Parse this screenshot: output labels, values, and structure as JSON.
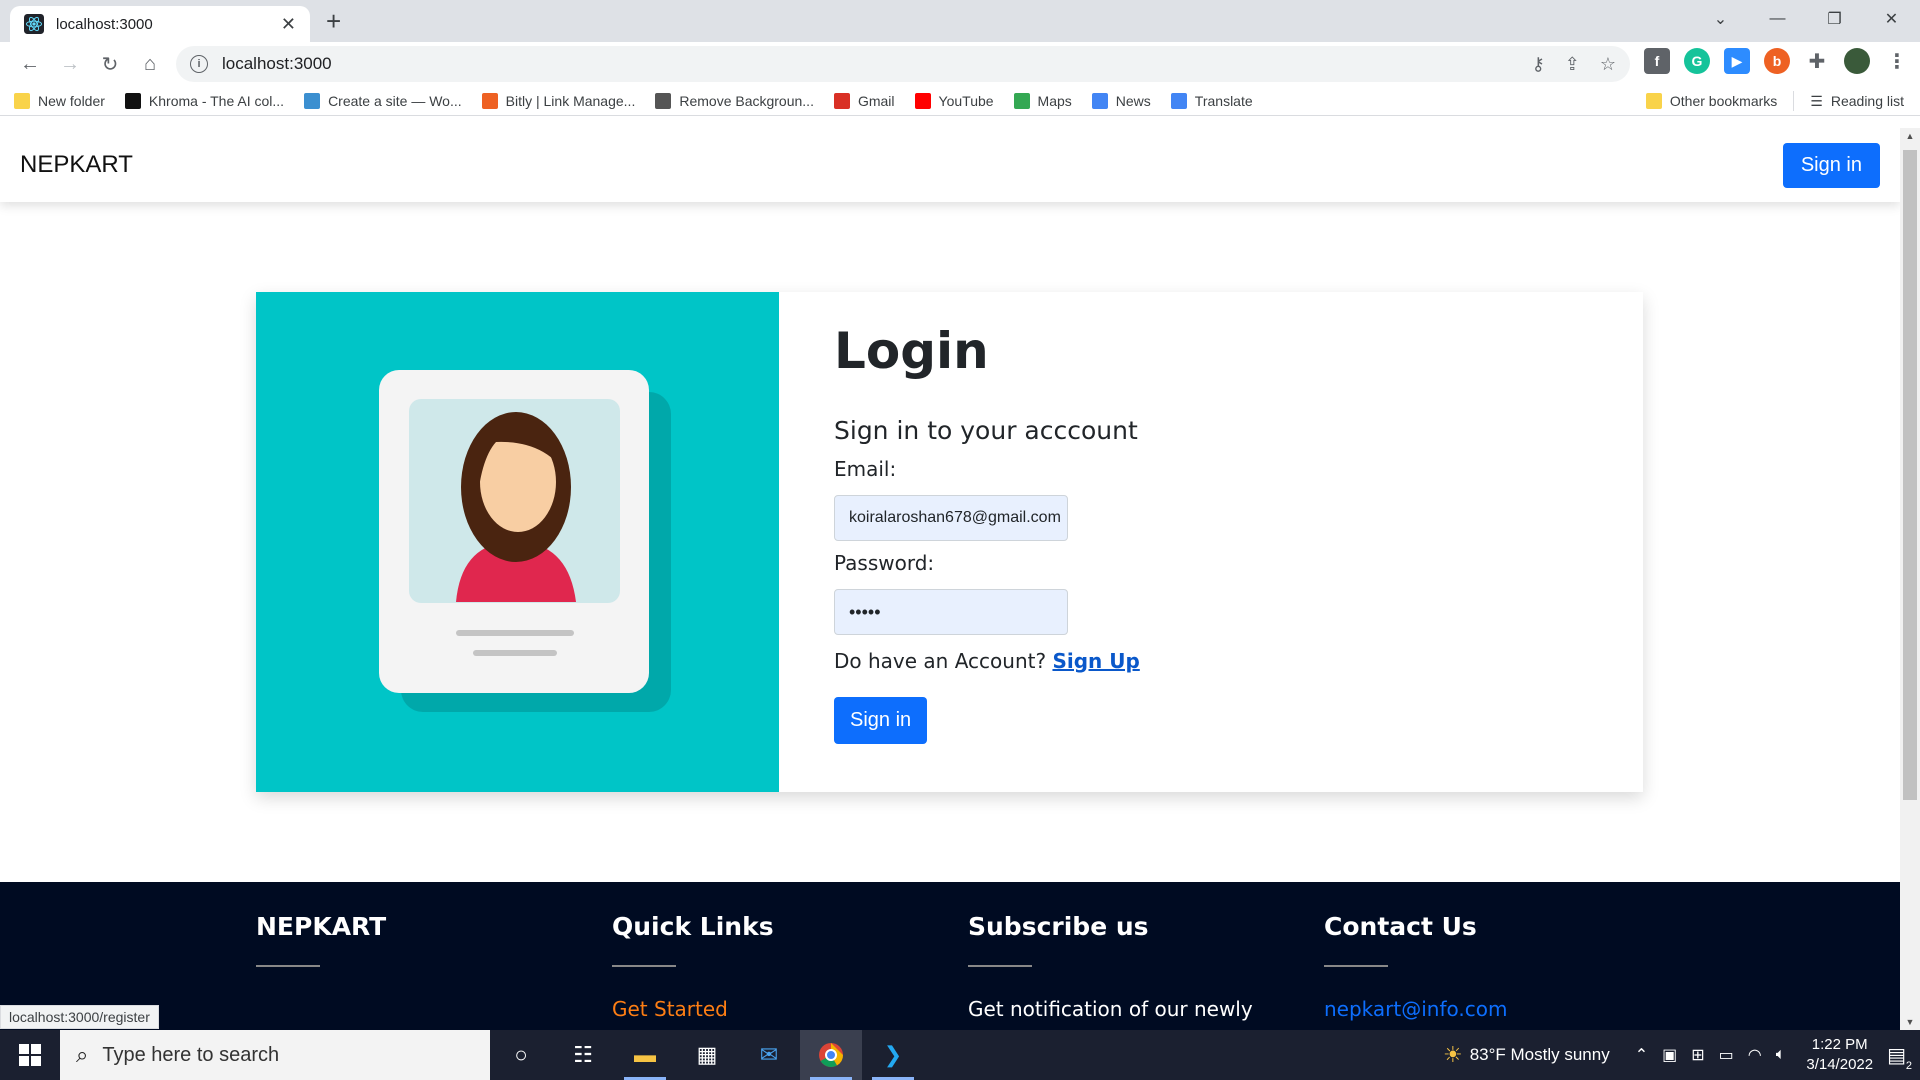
{
  "browser": {
    "tab_title": "localhost:3000",
    "tab_close": "✕",
    "new_tab": "+",
    "url": "localhost:3000",
    "bookmarks": [
      {
        "label": "New folder",
        "color": "#f9d34a"
      },
      {
        "label": "Khroma - The AI col...",
        "color": "#111111"
      },
      {
        "label": "Create a site — Wo...",
        "color": "#3b8fd0"
      },
      {
        "label": "Bitly | Link Manage...",
        "color": "#ee6123"
      },
      {
        "label": "Remove Backgroun...",
        "color": "#555555"
      },
      {
        "label": "Gmail",
        "color": "#d93025"
      },
      {
        "label": "YouTube",
        "color": "#ff0000"
      },
      {
        "label": "Maps",
        "color": "#34a853"
      },
      {
        "label": "News",
        "color": "#4285f4"
      },
      {
        "label": "Translate",
        "color": "#4285f4"
      }
    ],
    "other_bookmarks": "Other bookmarks",
    "reading_list": "Reading list",
    "status_url": "localhost:3000/register"
  },
  "navbar": {
    "brand": "NEPKART",
    "signin_label": "Sign in"
  },
  "login": {
    "title": "Login",
    "subtitle": "Sign in to your acccount",
    "email_label": "Email:",
    "email_value": "koiralaroshan678@gmail.com",
    "password_label": "Password:",
    "password_value": "•••••",
    "account_prompt": "Do have an Account?",
    "signup_link": "Sign Up",
    "signin_label": "Sign in"
  },
  "footer": {
    "col1_title": "NEPKART",
    "col2_title": "Quick Links",
    "col2_item": "Get Started",
    "col3_title": "Subscribe us",
    "col3_text": "Get notification of our newly",
    "col4_title": "Contact Us",
    "col4_email": "nepkart@info.com"
  },
  "taskbar": {
    "search_placeholder": "Type here to search",
    "weather": "83°F  Mostly sunny",
    "time": "1:22 PM",
    "date": "3/14/2022",
    "notifications": "2"
  },
  "colors": {
    "accent": "#0d6efd",
    "hero_bg": "#00c5c7",
    "footer_bg": "#000b22",
    "footer_link_orange": "#fd7e14",
    "footer_link_blue": "#0d6efd"
  }
}
